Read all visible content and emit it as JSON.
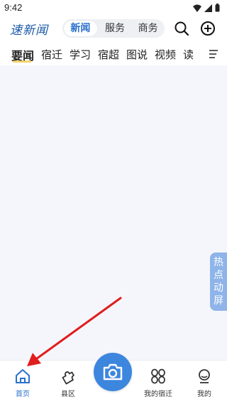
{
  "status_bar": {
    "time": "9:42"
  },
  "header": {
    "logo_text": "速新闻",
    "segments": [
      "新闻",
      "服务",
      "商务"
    ],
    "active_segment": 0
  },
  "channels": {
    "items": [
      "要闻",
      "宿迁",
      "学习",
      "宿超",
      "图说",
      "视频",
      "读"
    ]
  },
  "float_tab": {
    "label": [
      "热",
      "点",
      "动",
      "屏"
    ]
  },
  "bottom_nav": {
    "items": [
      "首页",
      "县区",
      "我的宿迁",
      "我的"
    ]
  },
  "colors": {
    "accent": "#2a6fce",
    "camera": "#3d86de",
    "float_tab": "#8eb4e9",
    "arrow": "#e11d1d",
    "content_bg": "#f5f6fb"
  }
}
